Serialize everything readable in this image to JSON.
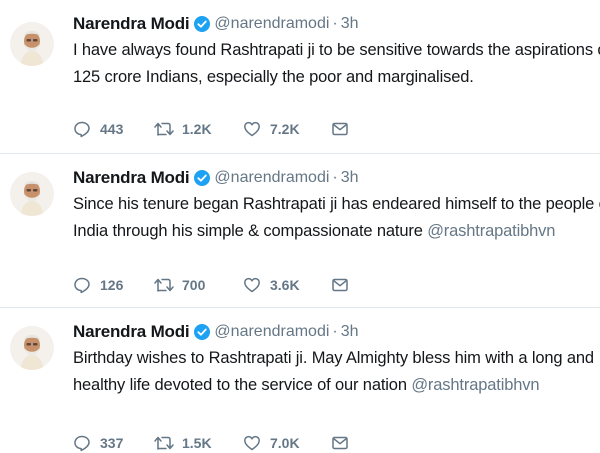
{
  "accent": "#1da1f2",
  "tweets": [
    {
      "author": "Narendra Modi",
      "handle": "@narendramodi",
      "separator": "·",
      "time": "3h",
      "line1": "I have always found Rashtrapati ji to be sensitive towards the aspirations of",
      "line2": "125 crore Indians, especially the poor and marginalised.",
      "mention": "",
      "replies": "443",
      "retweets": "1.2K",
      "likes": "7.2K"
    },
    {
      "author": "Narendra Modi",
      "handle": "@narendramodi",
      "separator": "·",
      "time": "3h",
      "line1": "Since his tenure began Rashtrapati ji has endeared himself to the people of",
      "line2": "India through his simple & compassionate nature ",
      "mention": "@rashtrapatibhvn",
      "replies": "126",
      "retweets": "700",
      "likes": "3.6K"
    },
    {
      "author": "Narendra Modi",
      "handle": "@narendramodi",
      "separator": "·",
      "time": "3h",
      "line1": "Birthday wishes to Rashtrapati ji. May Almighty bless him with a long and",
      "line2": "healthy life devoted to the service of our nation ",
      "mention": "@rashtrapatibhvn",
      "replies": "337",
      "retweets": "1.5K",
      "likes": "7.0K"
    }
  ]
}
